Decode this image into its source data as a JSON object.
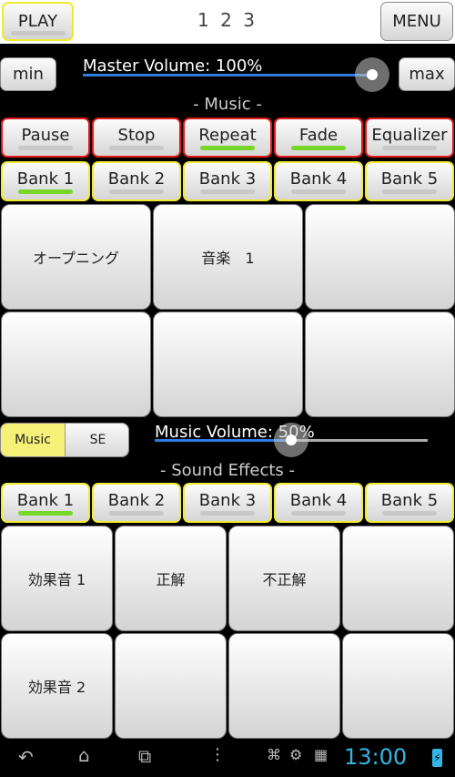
{
  "header": {
    "play_label": "PLAY",
    "pages": "1 2 3",
    "menu_label": "MENU"
  },
  "master": {
    "min_label": "min",
    "max_label": "max",
    "volume_label": "Master Volume: 100%",
    "level": 1.0
  },
  "music": {
    "section_title": "- Music -",
    "controls": [
      {
        "label": "Pause",
        "active": false
      },
      {
        "label": "Stop",
        "active": false
      },
      {
        "label": "Repeat",
        "active": true
      },
      {
        "label": "Fade",
        "active": true
      },
      {
        "label": "Equalizer",
        "active": false
      }
    ],
    "banks": [
      {
        "label": "Bank 1",
        "active": true
      },
      {
        "label": "Bank 2",
        "active": false
      },
      {
        "label": "Bank 3",
        "active": false
      },
      {
        "label": "Bank 4",
        "active": false
      },
      {
        "label": "Bank 5",
        "active": false
      }
    ],
    "pads": [
      "オープニング",
      "音楽　1",
      "",
      "",
      "",
      ""
    ]
  },
  "toggle": {
    "music_label": "Music",
    "se_label": "SE",
    "selected": "Music"
  },
  "music_volume": {
    "label": "Music Volume: 50%",
    "level": 0.5
  },
  "sfx": {
    "section_title": "- Sound Effects -",
    "banks": [
      {
        "label": "Bank 1",
        "active": true
      },
      {
        "label": "Bank 2",
        "active": false
      },
      {
        "label": "Bank 3",
        "active": false
      },
      {
        "label": "Bank 4",
        "active": false
      },
      {
        "label": "Bank 5",
        "active": false
      }
    ],
    "pads": [
      "効果音 1",
      "正解",
      "不正解",
      "",
      "効果音 2",
      "",
      "",
      ""
    ]
  },
  "statusbar": {
    "time": "13:00"
  },
  "colors": {
    "accent": "#2e7be0",
    "indicator_on": "#77d62a",
    "highlight": "#f0ea30"
  }
}
